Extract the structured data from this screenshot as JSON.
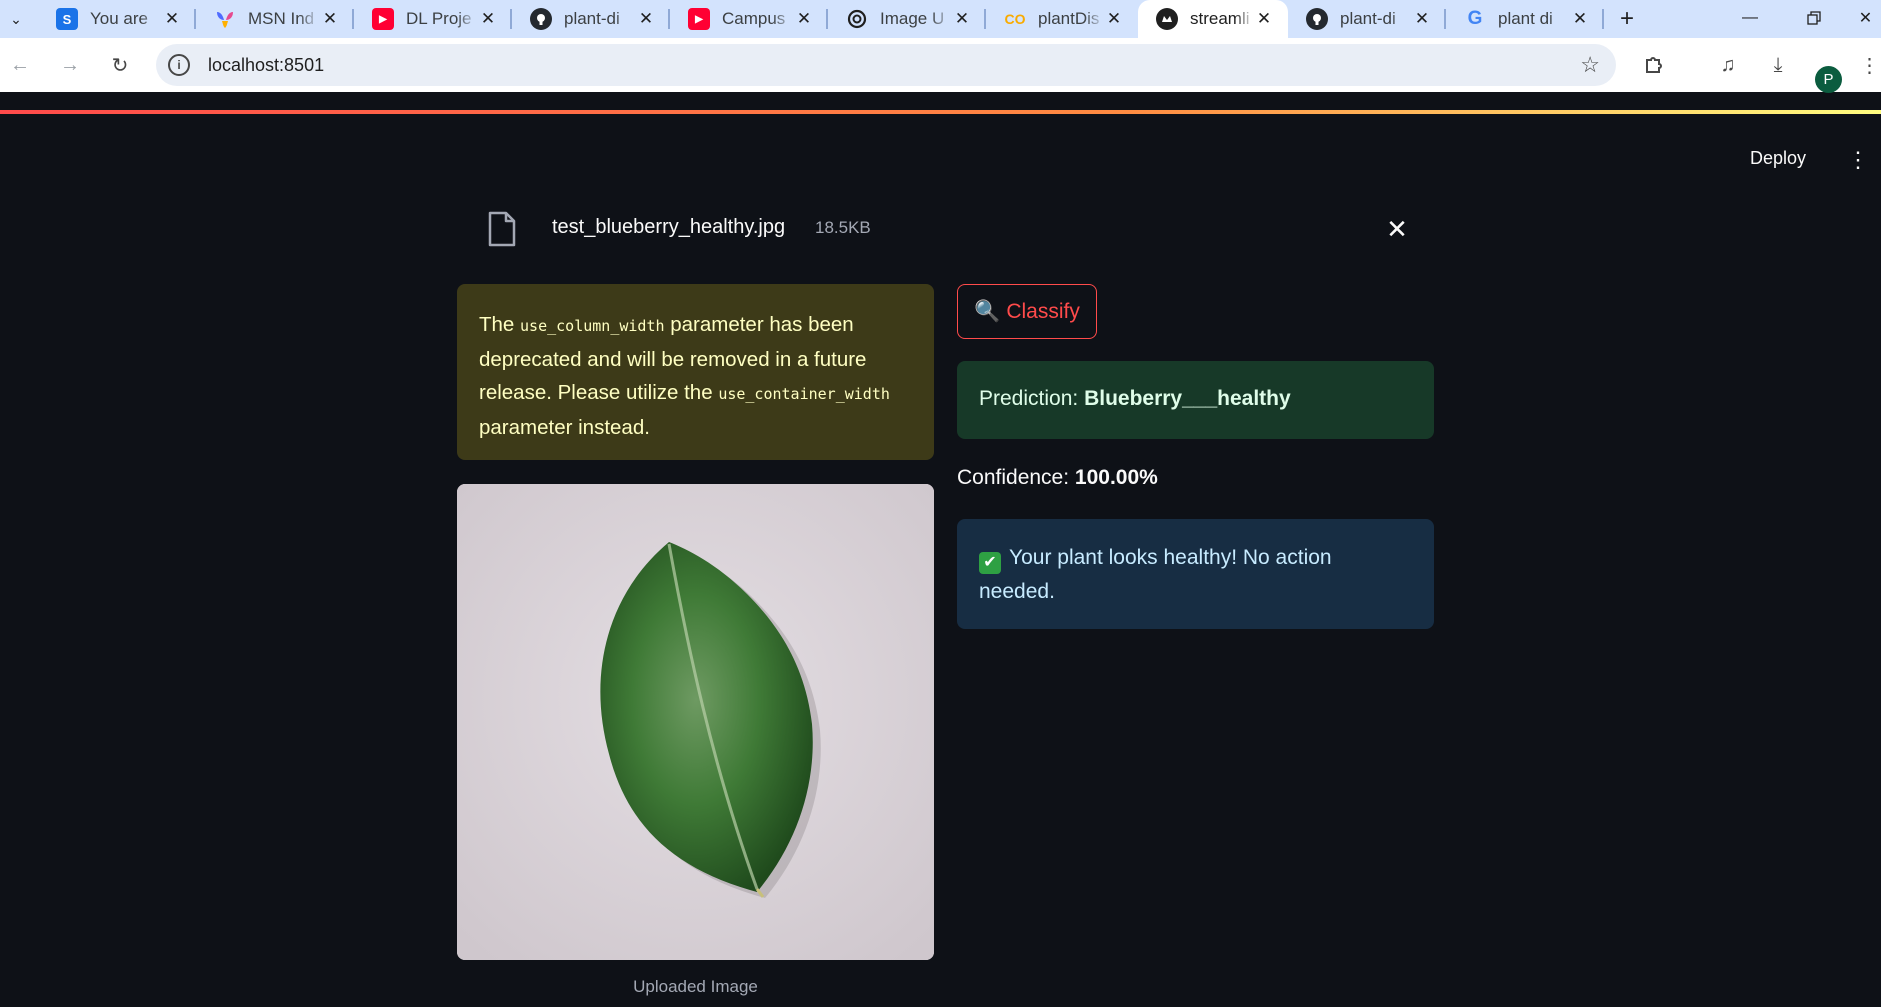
{
  "browser": {
    "tabs": [
      {
        "label": "You are",
        "favicon": "S",
        "favicon_color": "#1a73e8"
      },
      {
        "label": "MSN Ind",
        "favicon": "",
        "favicon_color": "#e64a8f"
      },
      {
        "label": "DL Proje",
        "favicon": "▶",
        "favicon_color": "#ff0033"
      },
      {
        "label": "plant-di",
        "favicon": "",
        "favicon_color": "#24292f"
      },
      {
        "label": "Campus",
        "favicon": "▶",
        "favicon_color": "#ff0033"
      },
      {
        "label": "Image U",
        "favicon": "",
        "favicon_color": "#1f1f1f"
      },
      {
        "label": "plantDis",
        "favicon": "CO",
        "favicon_color": "#f9ab00"
      },
      {
        "label": "streamli",
        "favicon": "",
        "favicon_color": "#1f1f1f"
      },
      {
        "label": "plant-di",
        "favicon": "",
        "favicon_color": "#24292f"
      },
      {
        "label": "plant di",
        "favicon": "G",
        "favicon_color": "#4285f4"
      }
    ],
    "active_tab": 7,
    "url": "localhost:8501",
    "profile_initial": "P"
  },
  "app": {
    "deploy_label": "Deploy",
    "file": {
      "name": "test_blueberry_healthy.jpg",
      "size": "18.5KB"
    },
    "warning": {
      "t1": "The ",
      "code1": "use_column_width",
      "t2": " parameter has been deprecated and will be removed in a future release. Please utilize the ",
      "code2": "use_container_width",
      "t3": " parameter instead."
    },
    "image_caption": "Uploaded Image",
    "classify_icon": "🔍",
    "classify_label": "Classify",
    "prediction_label": "Prediction: ",
    "prediction_value": "Blueberry___healthy",
    "confidence_label": "Confidence: ",
    "confidence_value": "100.00%",
    "status_icon": "✔",
    "status_message": "Your plant looks healthy! No action needed."
  },
  "colors": {
    "app_bg": "#0e1117",
    "primary": "#ff4b4b",
    "warning_bg": "#3d3a18",
    "success_bg": "#173928",
    "info_bg": "#172d43"
  }
}
